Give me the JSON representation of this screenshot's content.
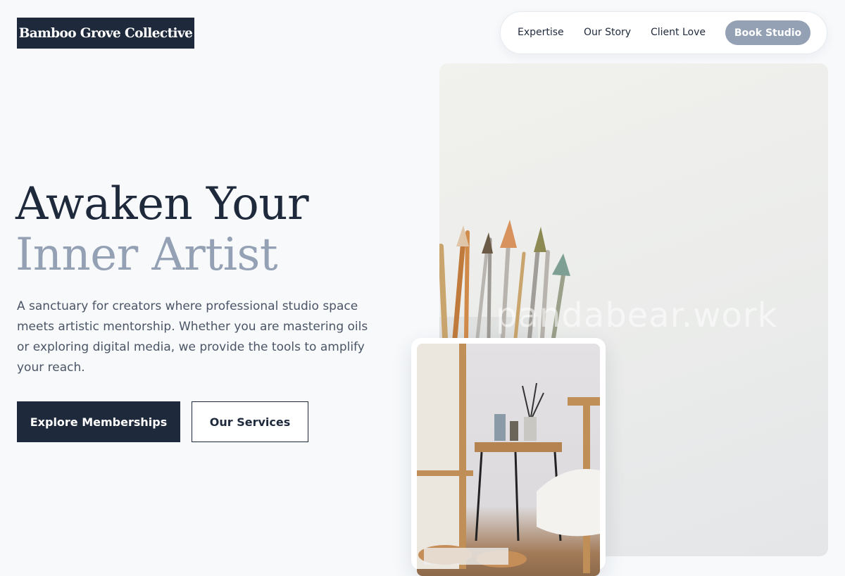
{
  "brand": {
    "name": "Bamboo Grove Collective"
  },
  "nav": {
    "items": [
      {
        "label": "Expertise"
      },
      {
        "label": "Our Story"
      },
      {
        "label": "Client Love"
      }
    ],
    "cta_label": "Book Studio"
  },
  "hero": {
    "headline_line1": "Awaken Your",
    "headline_line2": "Inner Artist",
    "lead": "A sanctuary for creators where professional studio space meets artistic mentorship. Whether you are mastering oils or exploring digital media, we provide the tools to amplify your reach.",
    "primary_cta": "Explore Memberships",
    "secondary_cta": "Our Services"
  },
  "images": {
    "main_watermark": "pandabear.work"
  },
  "colors": {
    "navy": "#1e293b",
    "slate": "#94a0b4",
    "page_bg": "#f7f9fb"
  }
}
